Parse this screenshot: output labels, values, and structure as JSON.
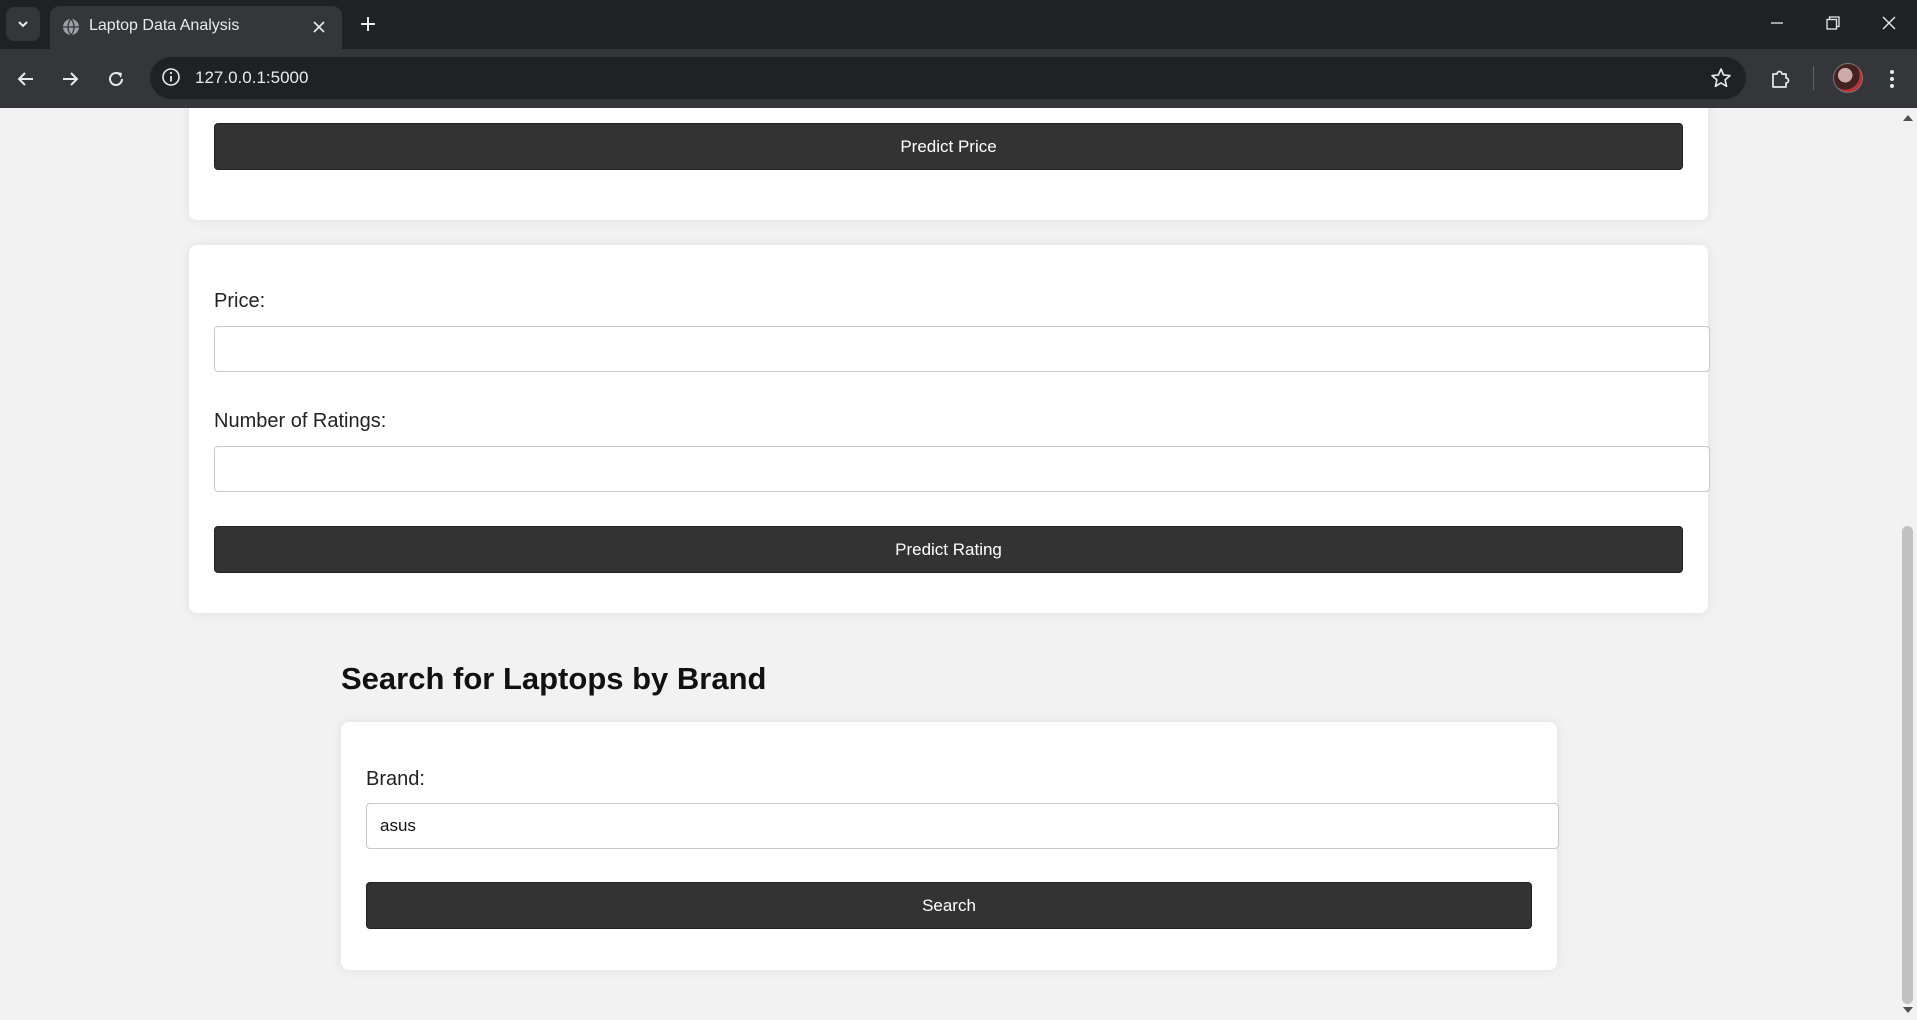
{
  "browser": {
    "tab_title": "Laptop Data Analysis",
    "url": "127.0.0.1:5000"
  },
  "price_form": {
    "submit_label": "Predict Price"
  },
  "rating_form": {
    "price_label": "Price:",
    "price_value": "",
    "ratings_label": "Number of Ratings:",
    "ratings_value": "",
    "submit_label": "Predict Rating"
  },
  "search": {
    "heading": "Search for Laptops by Brand",
    "brand_label": "Brand:",
    "brand_value": "asus",
    "submit_label": "Search"
  },
  "colors": {
    "button_bg": "#333333",
    "page_bg": "#f2f2f2",
    "card_bg": "#ffffff"
  }
}
